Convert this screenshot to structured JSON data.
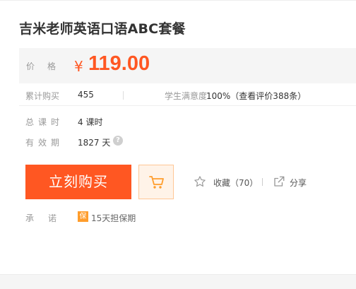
{
  "course": {
    "title": "吉米老师英语口语ABC套餐"
  },
  "price": {
    "label": "价格",
    "currency": "¥",
    "value": "119.00"
  },
  "stats": {
    "purchases_label": "累计购买",
    "purchases_value": "455",
    "satisfaction_label": "学生满意度",
    "satisfaction_value": "100%（查看评价388条）"
  },
  "details": {
    "total_lessons_label": "总课时",
    "total_lessons_value": "4 课时",
    "validity_label": "有效期",
    "validity_value": "1827 天",
    "help_icon": "question-circle-icon"
  },
  "actions": {
    "buy_label": "立刻购买",
    "cart_icon": "shopping-cart-icon",
    "favorite_icon": "star-icon",
    "favorite_label": "收藏（70）",
    "share_icon": "share-icon",
    "share_label": "分享"
  },
  "promise": {
    "label": "承诺",
    "badge": "保",
    "text": "15天担保期"
  },
  "colors": {
    "accent": "#ff5722",
    "cart_bg": "#fff3e8",
    "badge": "#ff9d2c"
  }
}
